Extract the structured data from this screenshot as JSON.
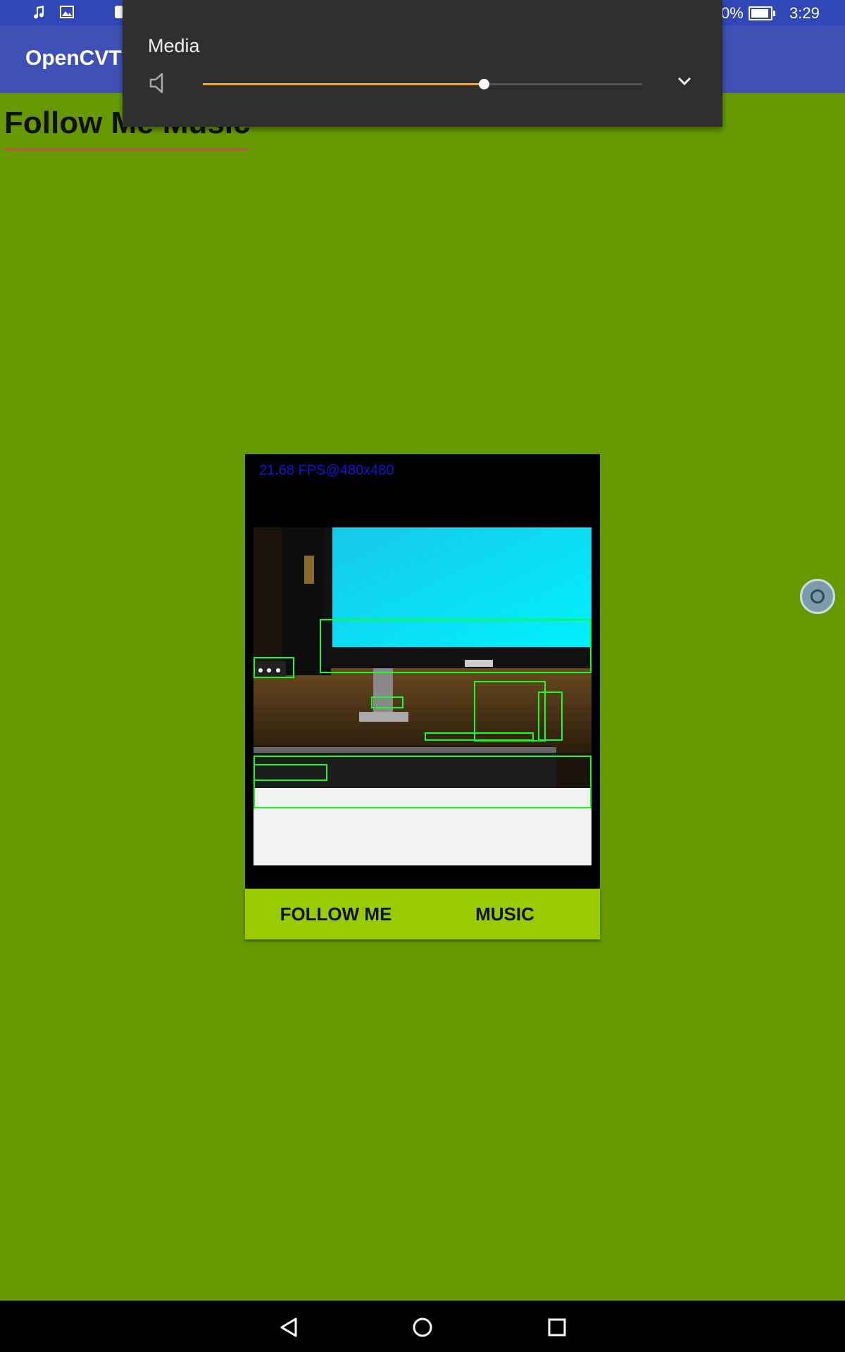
{
  "status_bar": {
    "battery_text": "0%",
    "time": "3:29",
    "icons": [
      "music-note-icon",
      "image-icon",
      "app-notification-icon",
      "battery-icon"
    ]
  },
  "app_bar": {
    "title": "OpenCVTE"
  },
  "page": {
    "heading": "Follow Me Music"
  },
  "volume_panel": {
    "label": "Media",
    "level": 0.64,
    "accent_color": "#f2a12a"
  },
  "camera": {
    "fps_text": "21.68 FPS@480x480"
  },
  "buttons": {
    "follow_me": "FOLLOW ME",
    "music": "MUSIC"
  },
  "colors": {
    "background": "#669900",
    "app_bar": "#3f51b5",
    "button_bar": "#99cc00",
    "detection_box": "#11ff22"
  },
  "nav_bar": {
    "icons": [
      "back-icon",
      "home-icon",
      "recents-icon"
    ]
  }
}
